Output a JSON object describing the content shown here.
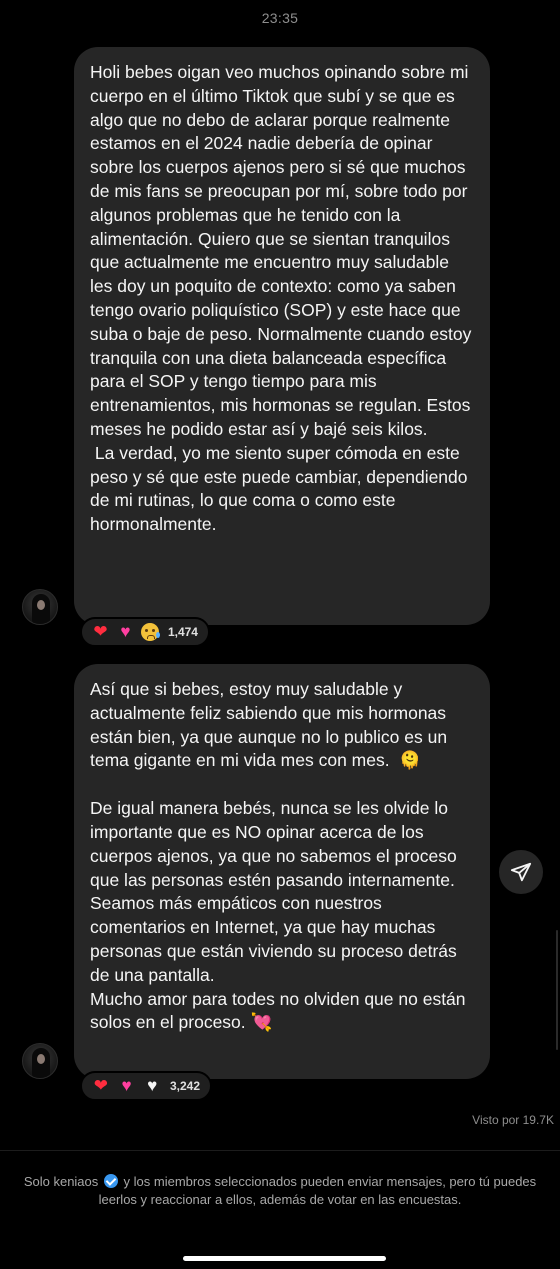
{
  "status": {
    "time": "23:35"
  },
  "messages": [
    {
      "paragraphs": [
        "Holi bebes oigan veo muchos opinando sobre mi cuerpo en el último Tiktok que subí y se que es algo que no debo de aclarar porque realmente estamos en el 2024 nadie debería de opinar sobre los cuerpos ajenos pero si sé que muchos de mis fans se preocupan por mí, sobre todo por algunos problemas que he tenido con la alimentación. Quiero que se sientan tranquilos que actualmente me encuentro muy saludable les doy un poquito de contexto: como ya saben tengo ovario poliquístico (SOP) y este hace que suba o baje de peso. Normalmente cuando estoy tranquila con una dieta balanceada específica para el SOP y tengo tiempo para mis entrenamientos, mis hormonas se regulan. Estos meses he podido estar así y bajé seis kilos.",
        " La verdad, yo me siento super cómoda en este peso y sé que este puede cambiar, dependiendo de mi rutinas, lo que coma o como este hormonalmente."
      ],
      "reactions": {
        "emojis": [
          "red-heart",
          "pink-heart",
          "sad-tear-face"
        ],
        "count": "1,474"
      }
    },
    {
      "paragraphs": [
        "Así que si bebes, estoy muy saludable y actualmente feliz sabiendo que mis hormonas están bien, ya que aunque no lo publico es un tema gigante en mi vida mes con mes.  🫠",
        "De igual manera bebés, nunca se les olvide lo importante que es NO opinar acerca de los cuerpos ajenos, ya que no sabemos el proceso que las personas estén pasando internamente. Seamos más empáticos con nuestros comentarios en Internet, ya que hay muchas personas que están viviendo su proceso detrás de una pantalla.",
        "Mucho amor para todes no olviden que no están solos en el proceso. 💘"
      ],
      "reactions": {
        "emojis": [
          "red-heart",
          "pink-heart",
          "white-heart"
        ],
        "count": "3,242"
      }
    }
  ],
  "seen_label": "Visto por 19.7K",
  "footer": {
    "username": "Solo keniaos",
    "text": "y los miembros seleccionados pueden enviar mensajes, pero tú puedes leerlos y reaccionar a ellos, además de votar en las encuestas."
  },
  "icons": {
    "share": "paper-plane-icon",
    "verified": "verified-badge-icon"
  },
  "colors": {
    "background": "#000000",
    "bubble": "#262626",
    "verified": "#3897f0"
  }
}
